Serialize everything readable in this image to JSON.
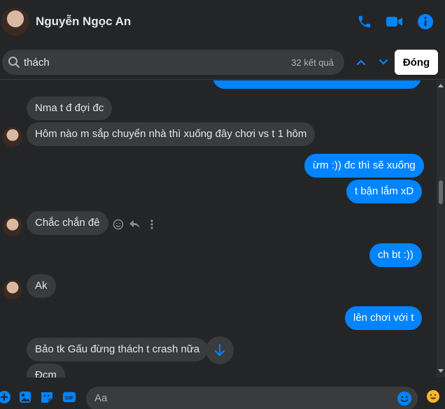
{
  "header": {
    "name": "Nguyễn Ngọc An"
  },
  "search": {
    "query": "thách",
    "count": "32 kết quả",
    "close_label": "Đóng"
  },
  "messages": [
    {
      "side": "in",
      "text": "Nma t đ đợi đc"
    },
    {
      "side": "in",
      "text": "Hôm nào m sắp chuyển nhà thì xuống đây chơi vs t 1 hôm"
    },
    {
      "side": "out",
      "text": "ừm :)) đc thì sẽ xuống"
    },
    {
      "side": "out",
      "text": "t bận lắm xD"
    },
    {
      "side": "in",
      "text": "Chắc chắn đê"
    },
    {
      "side": "out",
      "text": "ch bt :))"
    },
    {
      "side": "in",
      "text": "Ak"
    },
    {
      "side": "out",
      "text": "lên chơi với t"
    },
    {
      "side": "in",
      "text": "Bảo tk Gấu đừng thách t crash nữa"
    },
    {
      "side": "in",
      "text": "Đcm"
    }
  ],
  "composer": {
    "placeholder": "Aa"
  },
  "colors": {
    "accent": "#0084ff",
    "background": "#242526",
    "incoming_bubble": "#3a3b3c"
  },
  "icons": [
    "phone-icon",
    "video-icon",
    "info-icon",
    "search-icon",
    "chevron-up-icon",
    "chevron-down-icon",
    "emoji-icon",
    "reply-icon",
    "more-icon",
    "arrow-down-icon",
    "plus-icon",
    "image-icon",
    "sticker-icon",
    "gif-icon",
    "smiley-icon",
    "reaction-icon"
  ]
}
